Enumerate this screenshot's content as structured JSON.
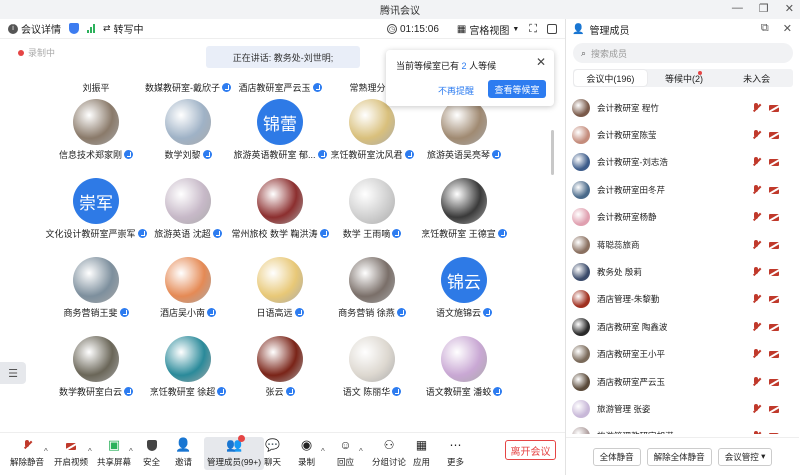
{
  "window": {
    "title": "腾讯会议"
  },
  "toolbar": {
    "meeting_info": "会议详情",
    "transcribe": "转写中",
    "timer": "01:15:06",
    "view_mode": "宫格视图"
  },
  "recording_label": "录制中",
  "speaker_banner": "正在讲话: 教务处-刘世明;",
  "waiting_popup": {
    "prefix": "当前等候室已有",
    "count": "2",
    "suffix": "人等候",
    "dismiss": "不再提醒",
    "view": "查看等候室"
  },
  "grid": {
    "top_row": [
      "刘振平",
      "数媒教研室-戴欣子",
      "酒店教研室严云玉",
      "常熟理分院"
    ],
    "tiles": [
      [
        {
          "name": "信息技术郑家刚",
          "avatar": "photo",
          "color": "#8a7a6a"
        },
        {
          "name": "数学刘黎",
          "avatar": "photo",
          "color": "#9fb2c6"
        },
        {
          "name": "旅游英语教研室 郁...",
          "avatar": "text",
          "text": "锦蕾"
        },
        {
          "name": "烹饪教研室沈风君",
          "avatar": "photo",
          "color": "#d9c07c"
        },
        {
          "name": "旅游英语吴亮琴",
          "avatar": "photo",
          "color": "#a08a72"
        }
      ],
      [
        {
          "name": "文化设计教研室严崇军",
          "avatar": "text",
          "text": "崇军"
        },
        {
          "name": "旅游英语 沈超",
          "avatar": "photo",
          "color": "#c7b9c8"
        },
        {
          "name": "常州旅校 数学 鞠洪涛",
          "avatar": "photo",
          "color": "#8c2f2f"
        },
        {
          "name": "数学 王雨嘀",
          "avatar": "photo",
          "color": "#d0d0d0"
        },
        {
          "name": "烹饪教研室 王德宣",
          "avatar": "photo",
          "color": "#3a3a3a"
        }
      ],
      [
        {
          "name": "商务营销王斐",
          "avatar": "photo",
          "color": "#7d8f9d"
        },
        {
          "name": "酒店吴小南",
          "avatar": "photo",
          "color": "#e58a55"
        },
        {
          "name": "日语高远",
          "avatar": "photo",
          "color": "#e8c877"
        },
        {
          "name": "商务营销 徐燕",
          "avatar": "photo",
          "color": "#7a6f69"
        },
        {
          "name": "语文施锦云",
          "avatar": "text",
          "text": "锦云"
        }
      ],
      [
        {
          "name": "数学教研室白云",
          "avatar": "photo",
          "color": "#6a6658"
        },
        {
          "name": "烹饪教研室 徐超",
          "avatar": "photo",
          "color": "#2a8a9a"
        },
        {
          "name": "张云",
          "avatar": "photo",
          "color": "#7a2418"
        },
        {
          "name": "语文 陈丽华",
          "avatar": "photo",
          "color": "#ddd8d0"
        },
        {
          "name": "语文教研室 潘蛟",
          "avatar": "photo",
          "color": "#c9a8d4"
        }
      ]
    ]
  },
  "bottom": {
    "mute": "解除静音",
    "video": "开启视频",
    "share": "共享屏幕",
    "security": "安全",
    "invite": "邀请",
    "members": "管理成员(99+)",
    "chat": "聊天",
    "record": "录制",
    "react": "回应",
    "breakout": "分组讨论",
    "apps": "应用",
    "more": "更多",
    "leave": "离开会议"
  },
  "panel": {
    "title": "管理成员",
    "search_placeholder": "搜索成员",
    "tabs": [
      "会议中(196)",
      "等候中(2)",
      "未入会"
    ],
    "members": [
      {
        "name": "会计教研室 程竹",
        "color": "#7a5a4a"
      },
      {
        "name": "会计教研室陈莹",
        "color": "#c48c7c"
      },
      {
        "name": "会计教研室-刘志浩",
        "color": "#3d5c8a"
      },
      {
        "name": "会计教研室田冬芹",
        "color": "#4a6a8a"
      },
      {
        "name": "会计教研室杨静",
        "color": "#e0a0b0"
      },
      {
        "name": "蒋聪蕊旅商",
        "color": "#8a7060"
      },
      {
        "name": "教务处 殷莉",
        "color": "#3a4a6a"
      },
      {
        "name": "酒店管理-朱黎勤",
        "color": "#a03020"
      },
      {
        "name": "酒店教研室 陶鑫波",
        "color": "#2a2a2a"
      },
      {
        "name": "酒店教研室王小平",
        "color": "#7a6a5a"
      },
      {
        "name": "酒店教研室严云玉",
        "color": "#5a4a3a"
      },
      {
        "name": "旅游管理 张姿",
        "color": "#c8b8d8"
      },
      {
        "name": "旅游管理教研室胡湛",
        "color": "#b0a0a0"
      }
    ],
    "mute_all": "全体静音",
    "unmute_all": "解除全体静音",
    "control": "会议管控"
  }
}
